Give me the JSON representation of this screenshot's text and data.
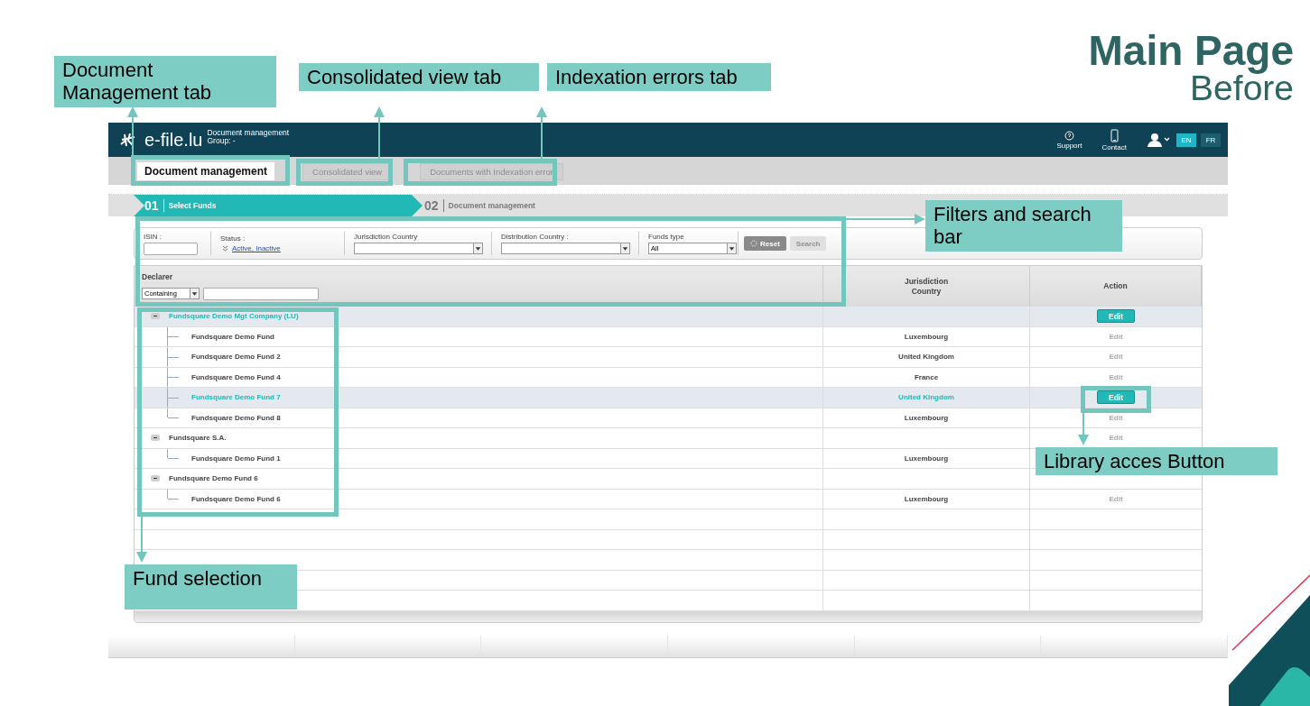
{
  "slide_title": {
    "line_1": "Main Page",
    "line_2": "Before"
  },
  "header": {
    "logo": "e-file.lu",
    "subtitle": [
      "Document management",
      "Group: -"
    ],
    "nav": [
      {
        "label": "Support",
        "kind": "help"
      },
      {
        "label": "Contact",
        "kind": "phone"
      }
    ],
    "languages": [
      {
        "label": "EN",
        "selected": true
      },
      {
        "label": "FR",
        "selected": false
      }
    ]
  },
  "tabs": [
    {
      "label": "Document management",
      "selected": true
    },
    {
      "label": "Consolidated view",
      "selected": false
    },
    {
      "label": "Documents with Indexation error",
      "selected": false
    }
  ],
  "steps": [
    {
      "number": "01",
      "label": "Select Funds",
      "selected": true
    },
    {
      "number": "02",
      "label": "Document management",
      "selected": false
    }
  ],
  "filters": {
    "isin": {
      "label": "ISIN :"
    },
    "status": {
      "label": "Status :",
      "value": "Active, Inactive"
    },
    "jurisdiction": {
      "label": "Jurisdiction Country"
    },
    "distribution": {
      "label": "Distribution Country :"
    },
    "funds_type": {
      "label": "Funds type",
      "value": "All"
    },
    "buttons": [
      {
        "label": "Reset",
        "disabled": false
      },
      {
        "label": "Search",
        "disabled": true
      }
    ]
  },
  "table": {
    "columns": [
      "Declarer",
      "Jurisdiction Country",
      "Action"
    ],
    "declarer_filter": {
      "mode": "Containing"
    },
    "rows": [
      {
        "name": "Fundsquare Demo Mgt Company (LU)",
        "selected": true,
        "expanded": true,
        "action": "Edit",
        "children": [
          {
            "name": "Fundsquare Demo Fund",
            "country": "Luxembourg",
            "action": "Edit",
            "selected": false
          },
          {
            "name": "Fundsquare Demo Fund 2",
            "country": "United Kingdom",
            "action": "Edit",
            "selected": false
          },
          {
            "name": "Fundsquare Demo Fund 4",
            "country": "France",
            "action": "Edit",
            "selected": false
          },
          {
            "name": "Fundsquare Demo Fund 7",
            "country": "United Kingdom",
            "action": "Edit",
            "selected": true
          },
          {
            "name": "Fundsquare Demo Fund 8",
            "country": "Luxembourg",
            "action": "Edit",
            "selected": false
          }
        ]
      },
      {
        "name": "Fundsquare S.A.",
        "selected": false,
        "expanded": true,
        "action": "Edit",
        "children": [
          {
            "name": "Fundsquare Demo Fund 1",
            "country": "Luxembourg",
            "selected": false
          }
        ]
      },
      {
        "name": "Fundsquare Demo Fund 6",
        "selected": false,
        "expanded": true,
        "children": [
          {
            "name": "Fundsquare Demo Fund 6",
            "country": "Luxembourg",
            "action": "Edit",
            "selected": false
          }
        ]
      }
    ]
  },
  "annotations": [
    {
      "text": "Document Management tab"
    },
    {
      "text": "Consolidated view tab"
    },
    {
      "text": "Indexation errors tab"
    },
    {
      "text": "Filters and search bar"
    },
    {
      "text": "Library acces Button"
    },
    {
      "text": "Fund selection"
    }
  ]
}
